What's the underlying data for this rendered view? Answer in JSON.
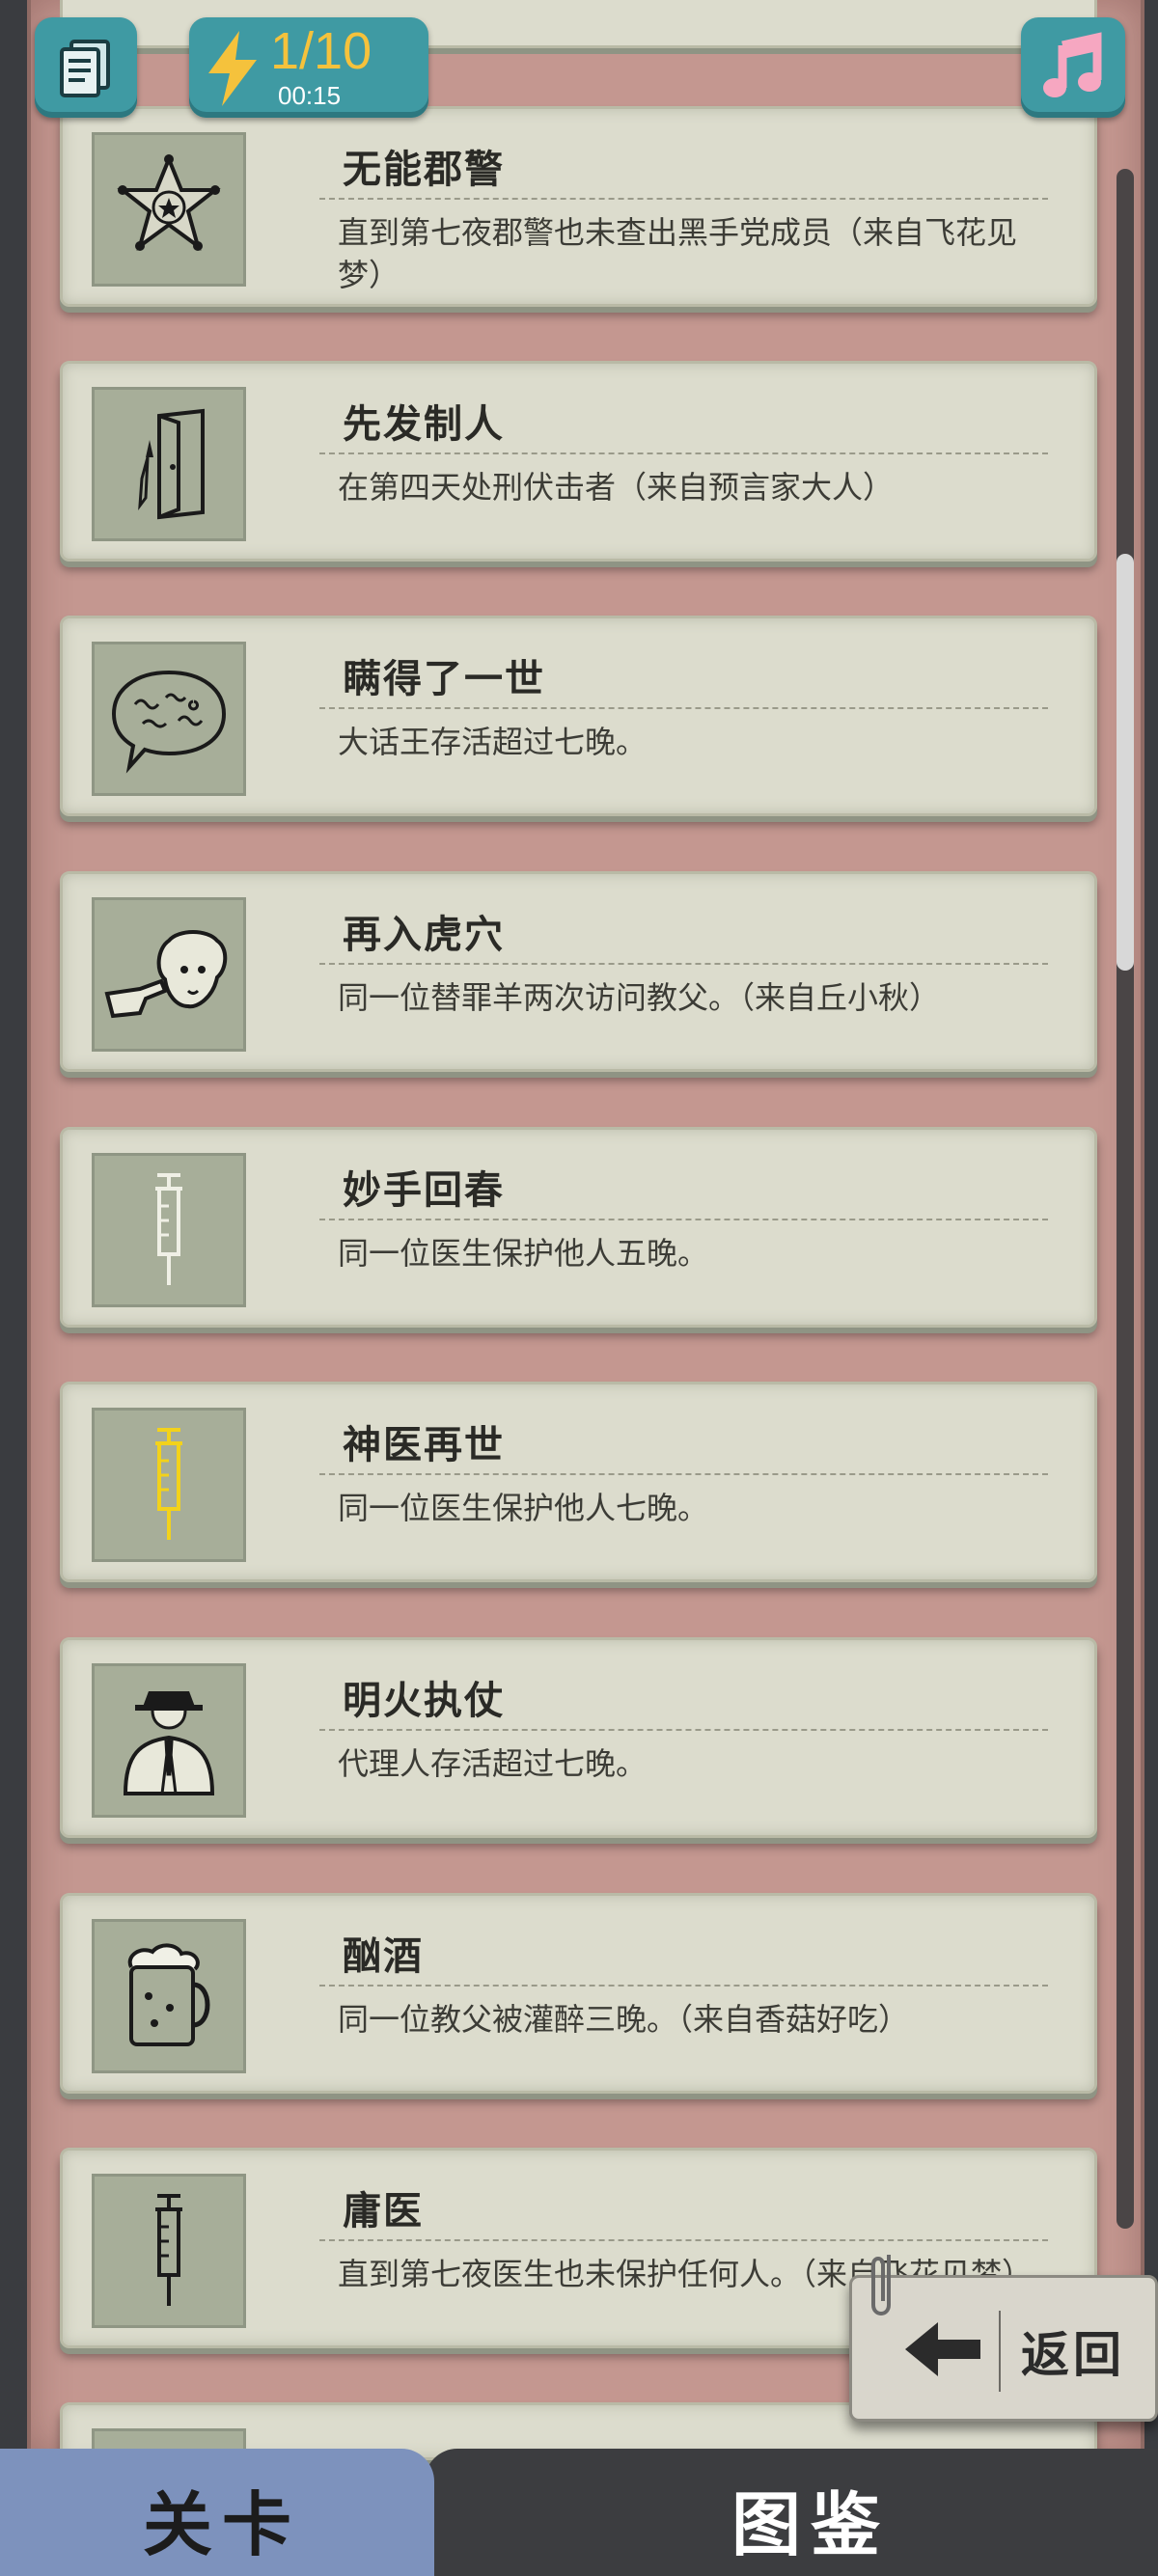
{
  "header": {
    "energy_count": "1/10",
    "energy_timer": "00:15",
    "documents_icon": "documents-icon",
    "energy_icon": "lightning-bolt-icon",
    "music_icon": "music-note-icon"
  },
  "achievements": [
    {
      "title": "无能郡警",
      "desc": "直到第七夜郡警也未查出黑手党成员（来自飞花见梦）",
      "icon": "sheriff-star-icon"
    },
    {
      "title": "先发制人",
      "desc": "在第四天处刑伏击者（来自预言家大人）",
      "icon": "knife-door-icon"
    },
    {
      "title": "瞒得了一世",
      "desc": "大话王存活超过七晚。",
      "icon": "speech-bubble-icon"
    },
    {
      "title": "再入虎穴",
      "desc": "同一位替罪羊两次访问教父。（来自丘小秋）",
      "icon": "sheep-pointing-icon"
    },
    {
      "title": "妙手回春",
      "desc": "同一位医生保护他人五晚。",
      "icon": "syringe-outline-icon"
    },
    {
      "title": "神医再世",
      "desc": "同一位医生保护他人七晚。",
      "icon": "syringe-gold-icon"
    },
    {
      "title": "明火执仗",
      "desc": "代理人存活超过七晚。",
      "icon": "gangster-icon"
    },
    {
      "title": "酗酒",
      "desc": "同一位教父被灌醉三晚。（来自香菇好吃）",
      "icon": "beer-mug-icon"
    },
    {
      "title": "庸医",
      "desc": "直到第七夜医生也未保护任何人。（来自飞花见梦）",
      "icon": "syringe-dark-icon"
    }
  ],
  "back_button": {
    "label": "返回",
    "icon": "arrow-left-icon"
  },
  "tabs": {
    "levels": "关卡",
    "codex": "图鉴"
  },
  "colors": {
    "accent_teal": "#3f9aa3",
    "energy_gold": "#f5c23c",
    "board_pink": "#c49790",
    "tab_active": "#7d92bd"
  }
}
